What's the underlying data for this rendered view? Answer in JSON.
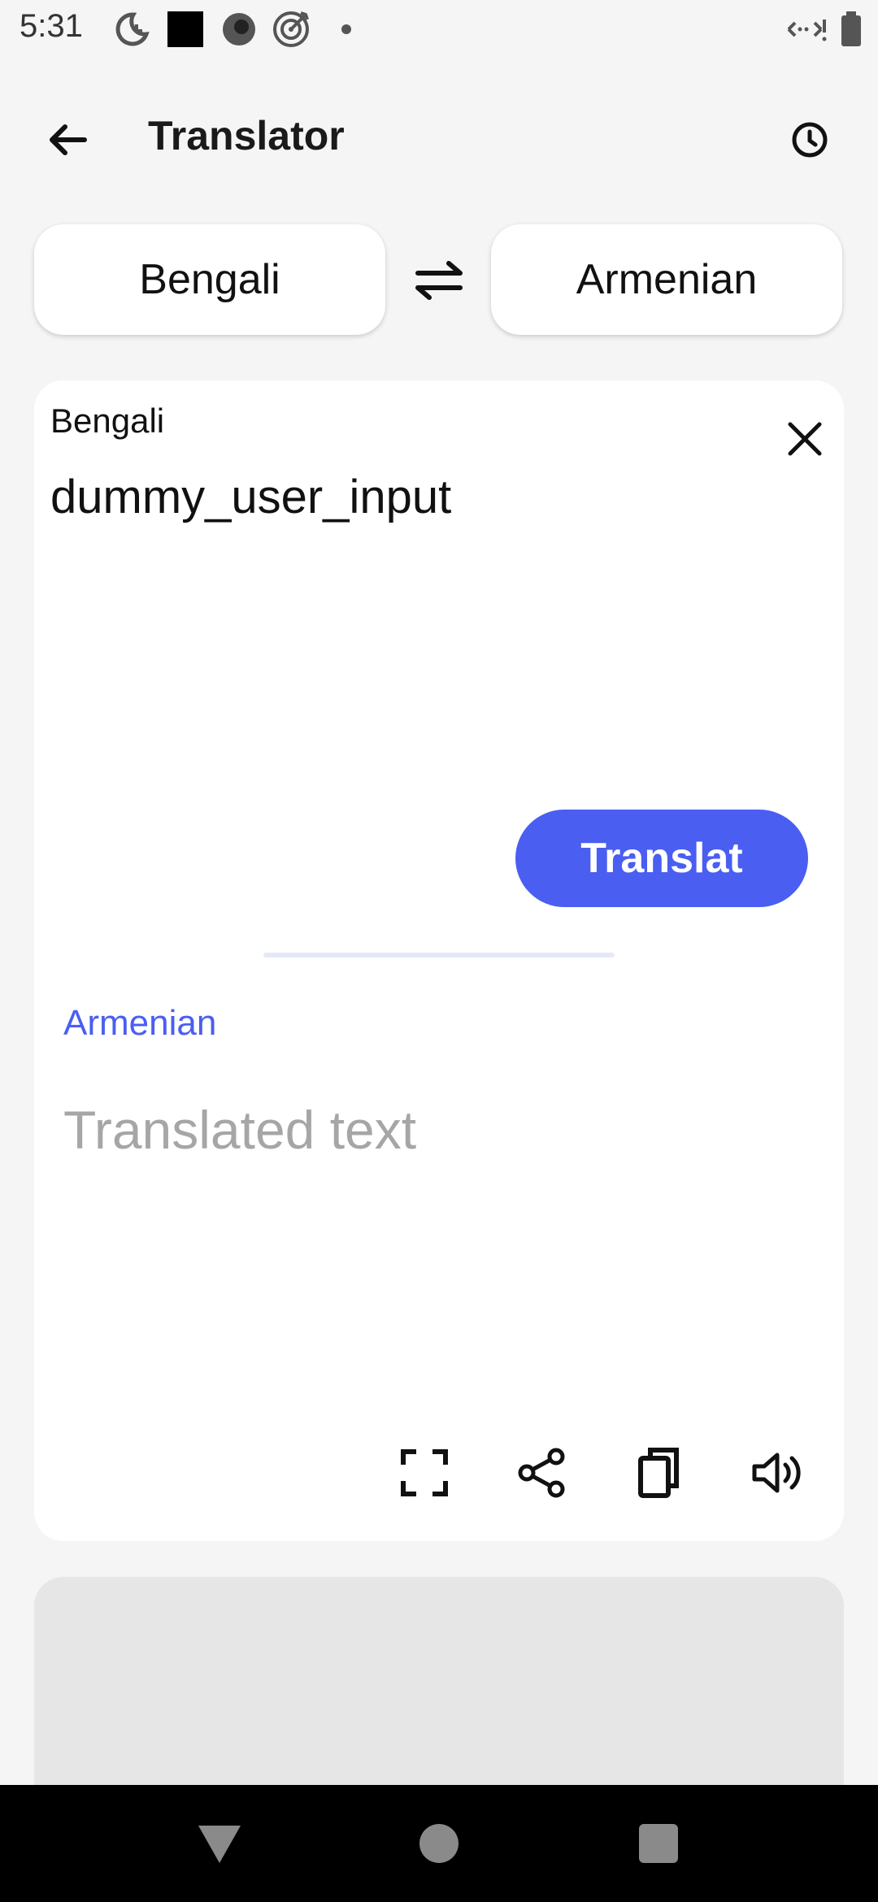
{
  "status_bar": {
    "time": "5:31",
    "left_icons": [
      "moon-clock-icon",
      "black-square-icon",
      "circle-record-icon",
      "target-icon",
      "dot-icon"
    ],
    "right_icons": [
      "signal-arrows-icon",
      "battery-icon"
    ]
  },
  "app_bar": {
    "title": "Translator",
    "back_icon": "arrow-left-icon",
    "history_icon": "clock-icon"
  },
  "language_selector": {
    "source": "Bengali",
    "target": "Armenian",
    "swap_icon": "swap-arrows-icon"
  },
  "input_panel": {
    "label": "Bengali",
    "text": "dummy_user_input",
    "clear_icon": "close-icon",
    "translate_button": "Translat"
  },
  "output_panel": {
    "label": "Armenian",
    "placeholder": "Translated text",
    "tools": [
      "fullscreen-icon",
      "share-icon",
      "copy-icon",
      "speaker-icon"
    ]
  },
  "colors": {
    "accent": "#4a5ef2",
    "background": "#f5f5f5",
    "card": "#ffffff",
    "placeholder": "#a6a6a6"
  },
  "nav_bar": {
    "buttons": [
      "back-triangle-icon",
      "home-circle-icon",
      "recents-square-icon"
    ]
  }
}
